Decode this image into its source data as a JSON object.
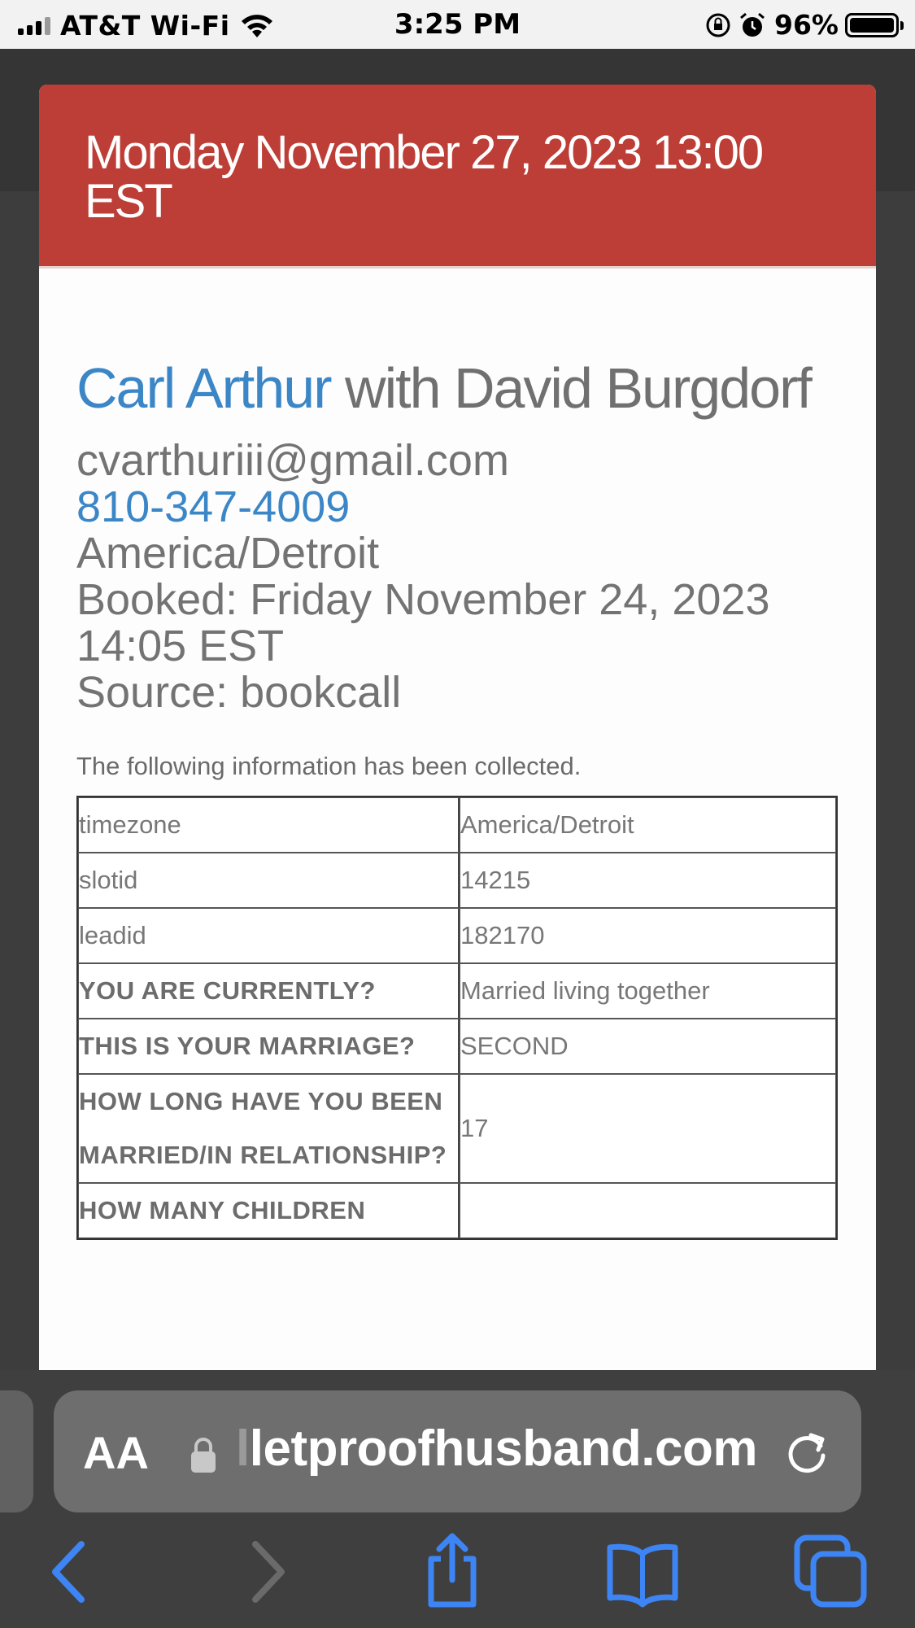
{
  "status": {
    "carrier": "AT&T Wi-Fi",
    "time": "3:25 PM",
    "battery": "96%"
  },
  "appointment": {
    "datetime": "Monday November 27, 2023 13:00 EST",
    "client_name": "Carl Arthur",
    "with_text": "with David Burgdorf",
    "email": "cvarthuriii@gmail.com",
    "phone": "810-347-4009",
    "timezone": "America/Detroit",
    "booked": "Booked: Friday November 24, 2023 14:05 EST",
    "source": "Source: bookcall"
  },
  "collected": {
    "note": "The following information has been collected.",
    "rows": [
      {
        "key": "timezone",
        "value": "America/Detroit"
      },
      {
        "key": "slotid",
        "value": "14215"
      },
      {
        "key": "leadid",
        "value": "182170"
      },
      {
        "key": "YOU ARE CURRENTLY?",
        "value": "Married living together"
      },
      {
        "key": "THIS IS YOUR MARRIAGE?",
        "value": "SECOND"
      },
      {
        "key": "HOW LONG HAVE YOU BEEN MARRIED/IN RELATIONSHIP?",
        "value": "17"
      },
      {
        "key": "HOW MANY CHILDREN",
        "value": ""
      }
    ]
  },
  "browser": {
    "aa_label": "AA",
    "url_fade": "l",
    "url": "letproofhusband.com"
  },
  "icons": {
    "wifi": "wifi-icon",
    "orientation_lock": "orientation-lock-icon",
    "alarm": "alarm-icon",
    "battery": "battery-icon",
    "lock": "lock-icon",
    "reload": "reload-icon",
    "back": "chevron-left-icon",
    "forward": "chevron-right-icon",
    "share": "share-icon",
    "bookmarks": "book-icon",
    "tabs": "tabs-icon"
  },
  "colors": {
    "header_red": "#bd3e36",
    "link_blue": "#3b86c6",
    "ios_blue": "#3d85f5"
  }
}
